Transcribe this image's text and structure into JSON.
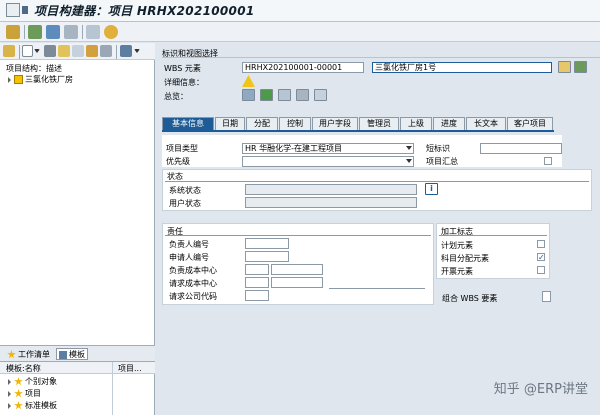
{
  "title": "项目构建器：项目 HRHX202100001",
  "header": {
    "section_label": "标识和视图选择"
  },
  "wbs": {
    "label": "WBS 元素",
    "value": "HRHX202100001-00001",
    "desc": "三氯化铁厂房1号"
  },
  "detail_info_label": "详细信息：",
  "overview_label": "总览：",
  "tree": {
    "header": "项目结构：描述",
    "item": "三氯化铁厂房"
  },
  "bottom_tabs": [
    "工作清单",
    "模板"
  ],
  "template": {
    "col1": "模板:名称",
    "col2": "项目...",
    "items": [
      "个别对象",
      "项目",
      "标准模板"
    ]
  },
  "tabs": [
    "基本信息",
    "日期",
    "分配",
    "控制",
    "用户字段",
    "管理员",
    "上级",
    "进度",
    "长文本",
    "客户项目"
  ],
  "basic": {
    "project_type_label": "项目类型",
    "project_type_value": "HR 华融化学-在建工程项目",
    "short_id_label": "短标识",
    "priority_label": "优先级",
    "project_summary_label": "项目汇总"
  },
  "status": {
    "title": "状态",
    "system_status": "系统状态",
    "user_status": "用户状态"
  },
  "responsibility": {
    "title": "责任",
    "rows": [
      "负责人编号",
      "申请人编号",
      "负责成本中心",
      "请求成本中心",
      "请求公司代码"
    ]
  },
  "operation_flags": {
    "title": "加工标志",
    "items": [
      "计划元素",
      "科目分配元素",
      "开票元素"
    ]
  },
  "grouping_wbs_label": "组合 WBS 要素",
  "watermark": "知乎 @ERP讲堂"
}
